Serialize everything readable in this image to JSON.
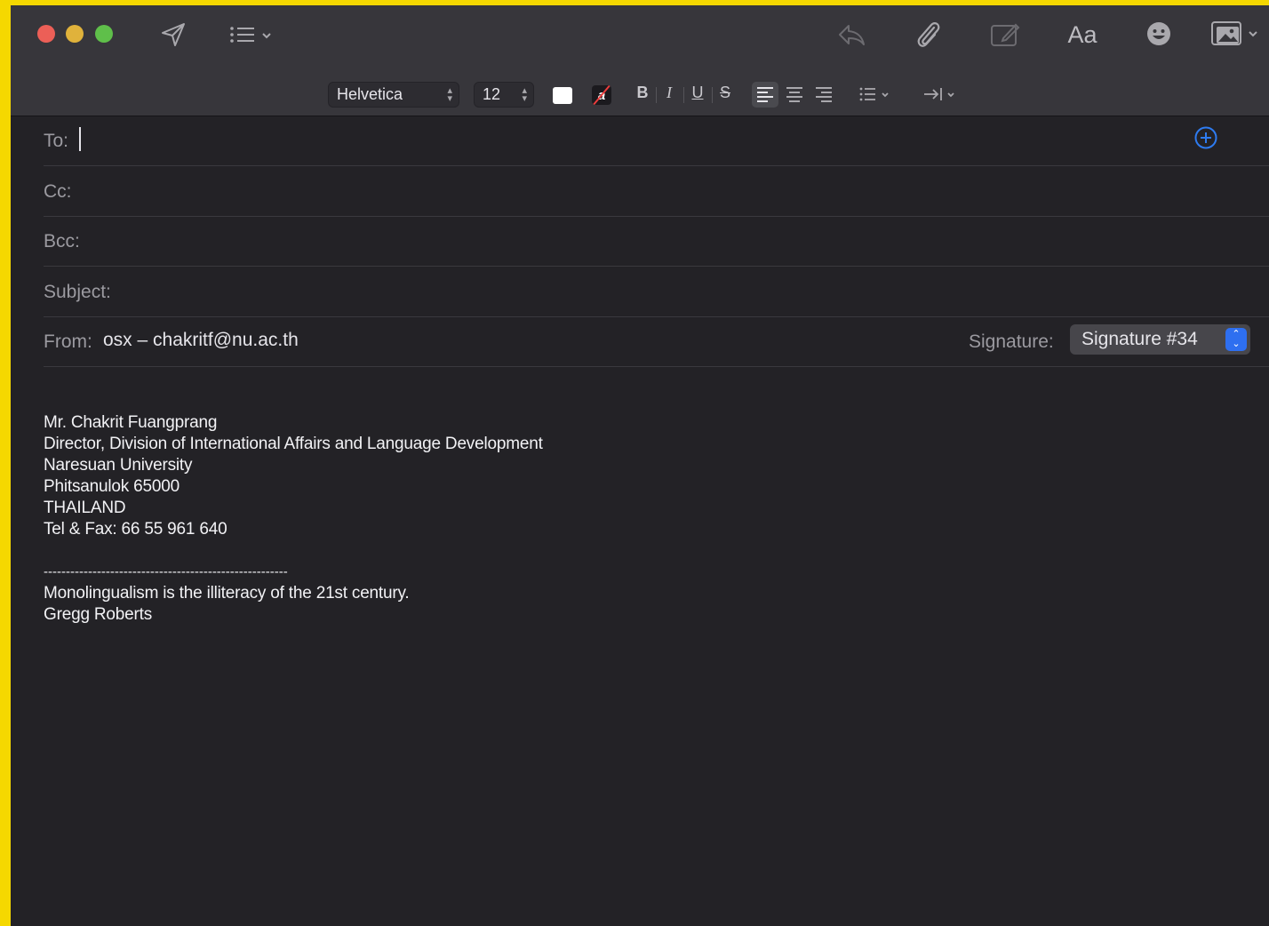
{
  "toolbar": {
    "send": "send-icon",
    "header_fields": "list-bullets-icon",
    "reply": "reply-icon",
    "attach": "paperclip-icon",
    "markup": "markup-icon",
    "format_label": "Aa",
    "emoji": "emoji-icon",
    "photo": "photo-browser-icon"
  },
  "format_bar": {
    "font": "Helvetica",
    "size": "12",
    "highlight_glyph": "a",
    "bold": "B",
    "italic": "I",
    "underline": "U",
    "strike": "S"
  },
  "fields": {
    "to_label": "To:",
    "cc_label": "Cc:",
    "bcc_label": "Bcc:",
    "subject_label": "Subject:",
    "from_label": "From:",
    "from_value": "osx – chakritf@nu.ac.th",
    "signature_label": "Signature:",
    "signature_value": "Signature #34"
  },
  "body": {
    "lines": [
      "Mr. Chakrit Fuangprang",
      "Director, Division of International Affairs and Language Development",
      "Naresuan University",
      "Phitsanulok 65000",
      "THAILAND",
      "Tel & Fax: 66 55 961 640"
    ],
    "divider": "-------------------------------------------------------",
    "quote": "Monolingualism is the illiteracy of the 21st century.",
    "quote_author": "Gregg Roberts"
  },
  "colors": {
    "accent": "#2e6ff0",
    "window_bg": "#232226",
    "toolbar_bg": "#37363b"
  }
}
